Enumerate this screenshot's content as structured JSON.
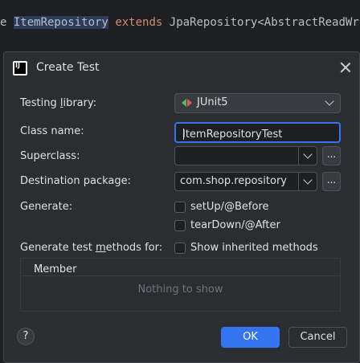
{
  "editor": {
    "code_prefix": "e ",
    "class_name": "ItemRepository",
    "keyword": "extends",
    "rest": "JpaRepository<AbstractReadWriteA"
  },
  "dialog": {
    "title": "Create Test",
    "labels": {
      "testing_library": "Testing library:",
      "class_name": "Class name:",
      "superclass": "Superclass:",
      "destination_package": "Destination package:",
      "generate": "Generate:",
      "generate_methods_for": "Generate test methods for:"
    },
    "testing_library": {
      "selected": "JUnit5",
      "icon": "junit-icon"
    },
    "class_name_value": "ItemRepositoryTest",
    "superclass_value": "",
    "destination_package_value": "com.shop.repository",
    "browse_label": "...",
    "generate_options": [
      {
        "label": "setUp/@Before",
        "checked": false
      },
      {
        "label": "tearDown/@After",
        "checked": false
      }
    ],
    "show_inherited": {
      "label": "Show inherited methods",
      "checked": false
    },
    "members_table": {
      "header_prefix": "...",
      "header": "Member",
      "empty_text": "Nothing to show"
    },
    "help_label": "?",
    "ok_label": "OK",
    "cancel_label": "Cancel"
  },
  "colors": {
    "accent": "#3574f0",
    "dialog_bg": "#2b2d30",
    "field_bg": "#1e1f22"
  }
}
